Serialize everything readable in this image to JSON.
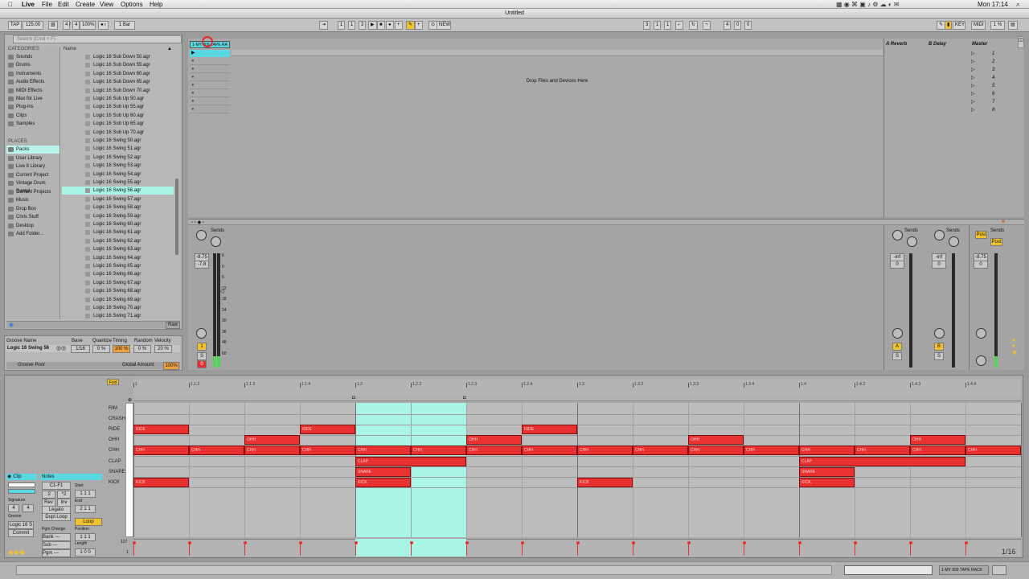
{
  "menubar": {
    "apple": "",
    "app": "Live",
    "items": [
      "File",
      "Edit",
      "Create",
      "View",
      "Options",
      "Help"
    ],
    "clock": "Mon 17:14"
  },
  "window": {
    "title": "Untitled"
  },
  "control_bar": {
    "tap": "TAP",
    "tempo": "125.00",
    "signature": [
      "4",
      "/",
      "4"
    ],
    "zoom": "100%",
    "quant": "1 Bar",
    "position": [
      "1",
      "1",
      "3"
    ],
    "new": "NEW",
    "loop_start": [
      "3",
      "1",
      "1"
    ],
    "loop_len": [
      "4",
      "0",
      "0"
    ],
    "key": "KEY",
    "midi": "MIDI",
    "cpu": "1 %"
  },
  "browser": {
    "search_placeholder": "Search (Cmd + F)",
    "categories_header": "CATEGORIES",
    "categories": [
      "Sounds",
      "Drums",
      "Instruments",
      "Audio Effects",
      "MIDI Effects",
      "Max for Live",
      "Plug-ins",
      "Clips",
      "Samples"
    ],
    "places_header": "PLACES",
    "places": [
      "Packs",
      "User Library",
      "Live 8 Library",
      "Current Project",
      "Vintage Drum Sampl",
      "Current Projects",
      "Music",
      "Drop Box",
      "Chris Stuff",
      "Desktop",
      "Add Folder..."
    ],
    "name_header": "Name",
    "files": [
      "Logic 16 Sub Down 50.agr",
      "Logic 16 Sub Down 55.agr",
      "Logic 16 Sub Down 60.agr",
      "Logic 16 Sub Down 65.agr",
      "Logic 16 Sub Down 70.agr",
      "Logic 16 Sub Up 50.agr",
      "Logic 16 Sub Up 55.agr",
      "Logic 16 Sub Up 60.agr",
      "Logic 16 Sub Up 65.agr",
      "Logic 16 Sub Up 70.agr",
      "Logic 16 Swing 50.agr",
      "Logic 16 Swing 51.agr",
      "Logic 16 Swing 52.agr",
      "Logic 16 Swing 53.agr",
      "Logic 16 Swing 54.agr",
      "Logic 16 Swing 55.agr",
      "Logic 16 Swing 56.agr",
      "Logic 16 Swing 57.agr",
      "Logic 16 Swing 58.agr",
      "Logic 16 Swing 59.agr",
      "Logic 16 Swing 60.agr",
      "Logic 16 Swing 61.agr",
      "Logic 16 Swing 62.agr",
      "Logic 16 Swing 63.agr",
      "Logic 16 Swing 64.agr",
      "Logic 16 Swing 65.agr",
      "Logic 16 Swing 66.agr",
      "Logic 16 Swing 67.agr",
      "Logic 16 Swing 68.agr",
      "Logic 16 Swing 69.agr",
      "Logic 16 Swing 70.agr",
      "Logic 16 Swing 71.agr"
    ],
    "selected_file_index": 16,
    "raw": "Raw"
  },
  "groove_pool": {
    "headers": [
      "Groove Name",
      "Base",
      "Quantize",
      "Timing",
      "Random",
      "Velocity"
    ],
    "row": [
      "Logic 16 Swing 56",
      "1/16",
      "0 %",
      "100 %",
      "0 %",
      "20 %"
    ],
    "label": "Groove Pool",
    "global_amount_label": "Global Amount",
    "global_amount": "100%"
  },
  "session": {
    "track_name": "1-MY 909 TAPE RACK",
    "drop_text": "Drop Files and Devices Here",
    "returns": [
      "A Reverb",
      "B Delay"
    ],
    "master": "Master",
    "scenes": [
      "1",
      "2",
      "3",
      "4",
      "5",
      "6",
      "7",
      "8"
    ]
  },
  "mixer": {
    "sends": "Sends",
    "track_vol": "-8.75",
    "track_peak": "-7.8",
    "return_vol": "-inf",
    "return_pan": "0",
    "master_vol": "-8.75",
    "master_pan": "0",
    "post": "Post",
    "track_number": "1",
    "solo": "S",
    "arm": "0",
    "return_letters": [
      "A",
      "B"
    ],
    "scale": [
      "6",
      "0",
      "6",
      "12",
      "18",
      "24",
      "30",
      "36",
      "48",
      "60"
    ]
  },
  "clip": {
    "clip_label": "Clip",
    "notes_label": "Notes",
    "range": "C1-F1",
    "signature_label": "Signature",
    "sig": [
      "4",
      "4"
    ],
    "groove_label": "Groove",
    "groove": "Logic 16 S",
    "commit": "Commit",
    "start": "Start",
    "end": "End",
    "loop": "Loop",
    "position": "Position",
    "length": "Length",
    "legato": "Legato",
    "dupl": "Dupl.Loop",
    "rev": "Rev",
    "inv": "Inv",
    "pgm": "Pgm Change",
    "bank": "Bank ---",
    "sub": "Sub ---",
    "pgm2": "Pgm ---",
    "fold": "Fold",
    "page": "1/16",
    "vel_top": "127",
    "vel_bot": "1"
  },
  "piano_roll": {
    "rows": [
      "RIM",
      "CRASH",
      "RIDE",
      "OHH",
      "CHH",
      "CLAP",
      "SNARE",
      "KICK"
    ],
    "ruler": [
      "1",
      "1.1.2",
      "1.1.3",
      "1.1.4",
      "1.2",
      "1.2.2",
      "1.2.3",
      "1.2.4",
      "1.3",
      "1.3.2",
      "1.3.3",
      "1.3.4",
      "1.4",
      "1.4.2",
      "1.4.3",
      "1.4.4"
    ],
    "notes": [
      {
        "row": "RIDE",
        "start": 0,
        "len": 1,
        "label": "RIDE"
      },
      {
        "row": "RIDE",
        "start": 3,
        "len": 1,
        "label": "RIDE"
      },
      {
        "row": "RIDE",
        "start": 7,
        "len": 1,
        "label": "RIDE"
      },
      {
        "row": "OHH",
        "start": 2,
        "len": 1,
        "label": "OHH"
      },
      {
        "row": "OHH",
        "start": 6,
        "len": 1,
        "label": "OHH"
      },
      {
        "row": "OHH",
        "start": 10,
        "len": 1,
        "label": "OHH"
      },
      {
        "row": "OHH",
        "start": 14,
        "len": 1,
        "label": "OHH"
      },
      {
        "row": "CHH",
        "start": 0,
        "len": 1,
        "label": "CHH"
      },
      {
        "row": "CHH",
        "start": 1,
        "len": 1,
        "label": "CHH"
      },
      {
        "row": "CHH",
        "start": 2,
        "len": 1,
        "label": "CHH"
      },
      {
        "row": "CHH",
        "start": 3,
        "len": 1,
        "label": "CHH"
      },
      {
        "row": "CHH",
        "start": 4,
        "len": 1,
        "label": "CHH"
      },
      {
        "row": "CHH",
        "start": 5,
        "len": 1,
        "label": "CHH"
      },
      {
        "row": "CHH",
        "start": 6,
        "len": 1,
        "label": "CHH"
      },
      {
        "row": "CHH",
        "start": 7,
        "len": 1,
        "label": "CHH"
      },
      {
        "row": "CHH",
        "start": 8,
        "len": 1,
        "label": "CHH"
      },
      {
        "row": "CHH",
        "start": 9,
        "len": 1,
        "label": "CHH"
      },
      {
        "row": "CHH",
        "start": 10,
        "len": 1,
        "label": "CHH"
      },
      {
        "row": "CHH",
        "start": 11,
        "len": 1,
        "label": "CHH"
      },
      {
        "row": "CHH",
        "start": 12,
        "len": 1,
        "label": "CHH"
      },
      {
        "row": "CHH",
        "start": 13,
        "len": 1,
        "label": "CHH"
      },
      {
        "row": "CHH",
        "start": 14,
        "len": 1,
        "label": "CHH"
      },
      {
        "row": "CHH",
        "start": 15,
        "len": 1,
        "label": "CHH"
      },
      {
        "row": "CLAP",
        "start": 4,
        "len": 2,
        "label": "CLAP"
      },
      {
        "row": "CLAP",
        "start": 12,
        "len": 3,
        "label": "CLAP"
      },
      {
        "row": "SNARE",
        "start": 4,
        "len": 1,
        "label": "SNARE"
      },
      {
        "row": "SNARE",
        "start": 12,
        "len": 1,
        "label": "SNARE"
      },
      {
        "row": "KICK",
        "start": 0,
        "len": 1,
        "label": "KICK"
      },
      {
        "row": "KICK",
        "start": 4,
        "len": 1,
        "label": "KICK"
      },
      {
        "row": "KICK",
        "start": 8,
        "len": 1,
        "label": "KICK"
      },
      {
        "row": "KICK",
        "start": 12,
        "len": 1,
        "label": "KICK"
      }
    ]
  },
  "status": {
    "track": "1-MY 909 TAPE RACK"
  }
}
